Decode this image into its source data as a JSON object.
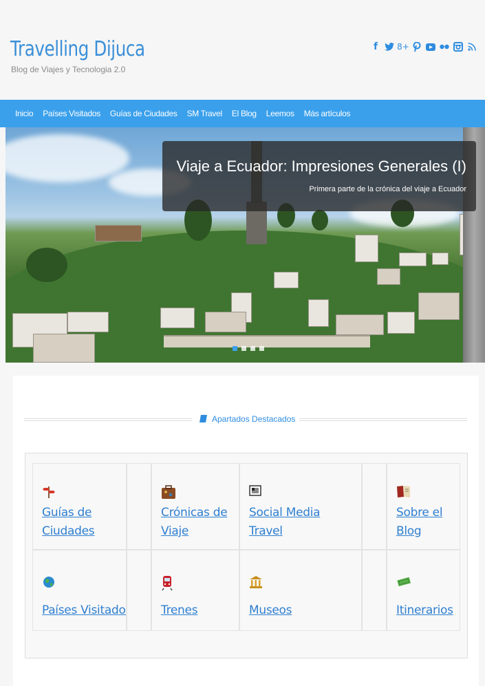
{
  "site": {
    "title": "Travelling Dijuca",
    "tagline": "Blog de Viajes y Tecnologia 2.0"
  },
  "social": [
    "facebook-icon",
    "twitter-icon",
    "googleplus-icon",
    "pinterest-icon",
    "youtube-icon",
    "flickr-icon",
    "instagram-icon",
    "rss-icon"
  ],
  "nav": {
    "items": [
      "Inicio",
      "Países Visitados",
      "Guías de Ciudades",
      "SM Travel",
      "El Blog",
      "Leemos",
      "Más artículos"
    ]
  },
  "slider": {
    "title": "Viaje a Ecuador: Impresiones Generales (I)",
    "subtitle": "Primera parte de la crónica del viaje a Ecuador"
  },
  "section": {
    "title": "Apartados Destacados"
  },
  "features": [
    {
      "line1": "Guías de",
      "line2": "Ciudades",
      "icon": "signpost-icon"
    },
    {
      "line1": "Crónicas de",
      "line2": "Viaje",
      "icon": "suitcase-icon"
    },
    {
      "line1": "Social Media",
      "line2": "Travel",
      "icon": "picture-frame-icon"
    },
    {
      "line1": "Sobre el",
      "line2": "Blog",
      "icon": "book-icon"
    },
    {
      "line1": "Países Visitados",
      "icon": "globe-icon"
    },
    {
      "line1": "Trenes",
      "icon": "train-icon"
    },
    {
      "line1": "Museos",
      "icon": "museum-icon"
    },
    {
      "line1": "Itinerarios",
      "icon": "ticket-icon"
    }
  ],
  "colors": {
    "accent": "#3aa0ec",
    "link": "#2f7fd0"
  }
}
